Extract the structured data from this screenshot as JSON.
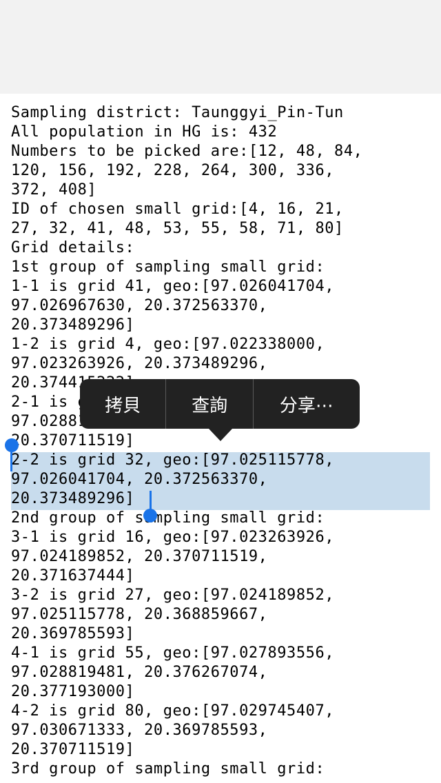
{
  "document": {
    "lines": [
      "Sampling district: Taunggyi_Pin-Tun",
      "All population in HG is: 432",
      "Numbers to be picked are:[12, 48, 84,",
      "120, 156, 192, 228, 264, 300, 336,",
      "372, 408]",
      "ID of chosen small grid:[4, 16, 21,",
      "27, 32, 41, 48, 53, 55, 58, 71, 80]",
      "Grid details:",
      "1st group of sampling small grid:",
      "1-1 is grid 41, geo:[97.026041704,",
      "97.026967630, 20.372563370,",
      "20.373489296]",
      "1-2 is grid 4, geo:[97.022338000,",
      "97.023263926, 20.373489296,",
      "20.374415222]",
      "2-1 is grid 21, geo:[97.027893556,",
      "97.028819481, 20.369785593,",
      "20.370711519]",
      "2-2 is grid 32, geo:[97.025115778,",
      "97.026041704, 20.372563370,",
      "20.373489296]",
      "2nd group of sampling small grid:",
      "3-1 is grid 16, geo:[97.023263926,",
      "97.024189852, 20.370711519,",
      "20.371637444]",
      "3-2 is grid 27, geo:[97.024189852,",
      "97.025115778, 20.368859667,",
      "20.369785593]",
      "4-1 is grid 55, geo:[97.027893556,",
      "97.028819481, 20.376267074,",
      "20.377193000]",
      "4-2 is grid 80, geo:[97.029745407,",
      "97.030671333, 20.369785593,",
      "20.370711519]",
      "3rd group of sampling small grid:"
    ]
  },
  "context_menu": {
    "copy_label": "拷貝",
    "lookup_label": "查詢",
    "share_label": "分享⋯"
  },
  "colors": {
    "selection": "#c8dced",
    "handle": "#1a73e8",
    "menu_background": "#222222"
  }
}
